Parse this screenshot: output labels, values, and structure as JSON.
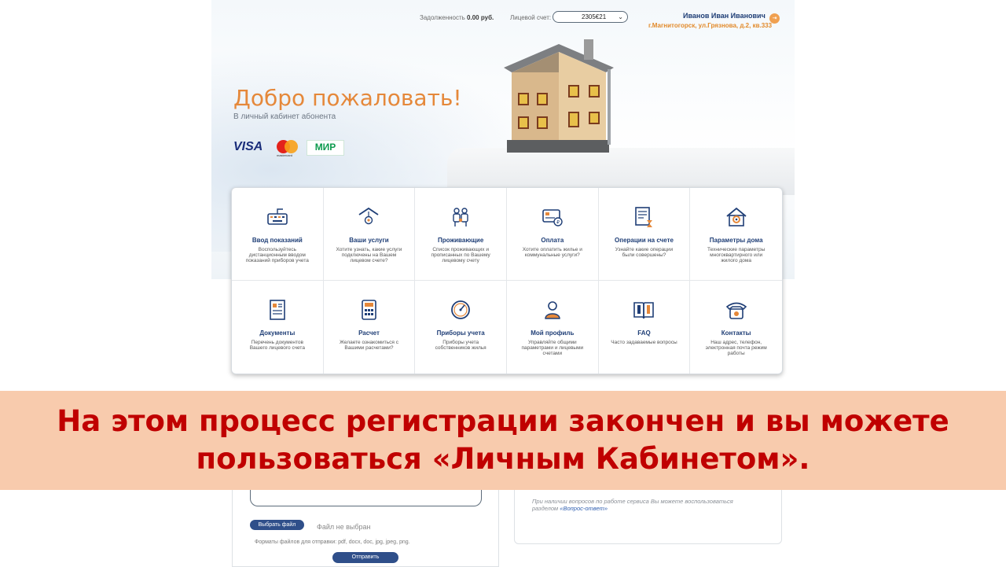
{
  "header": {
    "debt_label": "Задолженность",
    "debt_value": "0.00 руб.",
    "account_label": "Лицевой счет:",
    "account_value": "2305€21",
    "user_name": "Иванов Иван Иванович",
    "user_address": "г.Магнитогорск, ул.Грязнова, д.2, кв.333"
  },
  "hero": {
    "title": "Добро пожаловать!",
    "subtitle": "В личный кабинет абонента",
    "payments": {
      "visa": "VISA",
      "mastercard": "mastercard",
      "mir": "МИР"
    }
  },
  "tiles": [
    {
      "icon": "keyboard-icon",
      "title": "Ввод показаний",
      "desc": "Воспользуйтесь дистанционным вводом показаний приборов учета"
    },
    {
      "icon": "lamp-icon",
      "title": "Ваши услуги",
      "desc": "Хотите узнать, какие услуги подключены на Вашем лицевом счете?"
    },
    {
      "icon": "family-icon",
      "title": "Проживающие",
      "desc": "Список проживающих и прописанных по Вашему лицевому счету"
    },
    {
      "icon": "card-icon",
      "title": "Оплата",
      "desc": "Хотите оплатить жилье и коммунальные услуги?"
    },
    {
      "icon": "document-hourglass-icon",
      "title": "Операции на счете",
      "desc": "Узнайте какие операции были совершены?"
    },
    {
      "icon": "house-gear-icon",
      "title": "Параметры дома",
      "desc": "Технические параметры многоквартирного или жилого дома"
    },
    {
      "icon": "id-document-icon",
      "title": "Документы",
      "desc": "Перечень документов Вашего лицевого счета"
    },
    {
      "icon": "calculator-icon",
      "title": "Расчет",
      "desc": "Желаете ознакомиться с Вашими расчетами?"
    },
    {
      "icon": "meter-gauge-icon",
      "title": "Приборы учета",
      "desc": "Приборы учета собственников жилья"
    },
    {
      "icon": "user-profile-icon",
      "title": "Мой профиль",
      "desc": "Управляйте общими параметрами и лицевыми счетами"
    },
    {
      "icon": "faq-book-icon",
      "title": "FAQ",
      "desc": "Часто задаваемые вопросы"
    },
    {
      "icon": "phone-icon",
      "title": "Контакты",
      "desc": "Наш адрес, телефон, электронная почта режим работы"
    }
  ],
  "banner": {
    "text": "На этом процесс регистрации закончен и вы можете пользоваться «Личным Кабинетом»."
  },
  "upload": {
    "choose_label": "Выбрать файл",
    "no_file": "Файл не выбран",
    "formats": "Форматы файлов для отправки: pdf, docx, doc, jpg, jpeg, png.",
    "send_label": "Отправить"
  },
  "faq_note": {
    "text": "При наличии вопросов по работе сервиса Вы можете воспользоваться разделом",
    "link": "«Вопрос-ответ»"
  },
  "colors": {
    "brand_blue": "#1f3e76",
    "accent_orange": "#e5883a",
    "banner_bg": "#f8cbad",
    "banner_text": "#c00000"
  }
}
